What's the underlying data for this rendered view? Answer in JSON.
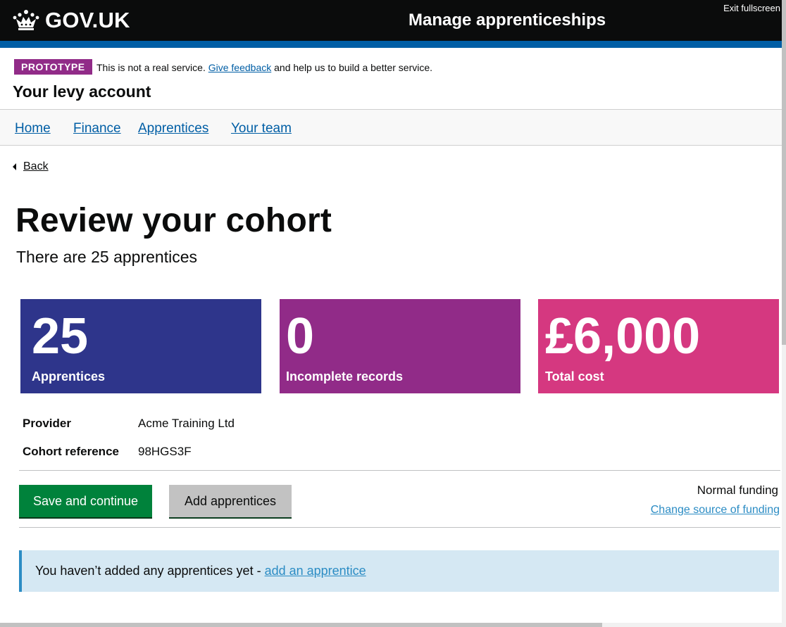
{
  "header": {
    "logo_text": "GOV.UK",
    "service_name": "Manage apprenticeships",
    "exit_fullscreen": "Exit fullscreen"
  },
  "phase_banner": {
    "tag": "PROTOTYPE",
    "text_before": "This is not a real service. ",
    "link": "Give feedback",
    "text_after": " and help us to build a better service."
  },
  "account_title": "Your levy account",
  "nav": {
    "items": [
      {
        "label": "Home"
      },
      {
        "label": "Finance"
      },
      {
        "label": "Apprentices"
      },
      {
        "label": "Your team"
      }
    ]
  },
  "back_link": "Back",
  "page": {
    "title": "Review your cohort",
    "lede": "There are 25 apprentices"
  },
  "stats": [
    {
      "value": "25",
      "label": "Apprentices",
      "color": "#2e358b"
    },
    {
      "value": "0",
      "label": "Incomplete records",
      "color": "#912b88"
    },
    {
      "value": "£6,000",
      "label": "Total cost",
      "color": "#d53880"
    }
  ],
  "summary": [
    {
      "key": "Provider",
      "value": "Acme Training Ltd"
    },
    {
      "key": "Cohort reference",
      "value": "98HGS3F"
    }
  ],
  "actions": {
    "save_label": "Save and continue",
    "add_label": "Add apprentices",
    "funding_status": "Normal funding",
    "change_funding_link": "Change source of funding"
  },
  "notice": {
    "text": "You haven’t added any apprentices yet - ",
    "link": "add an apprentice"
  },
  "colors": {
    "header_bg": "#0b0c0c",
    "brand_stripe": "#005ea5",
    "link": "#005ea5",
    "primary_button": "#00823b",
    "notice_bg": "#d5e8f3"
  }
}
